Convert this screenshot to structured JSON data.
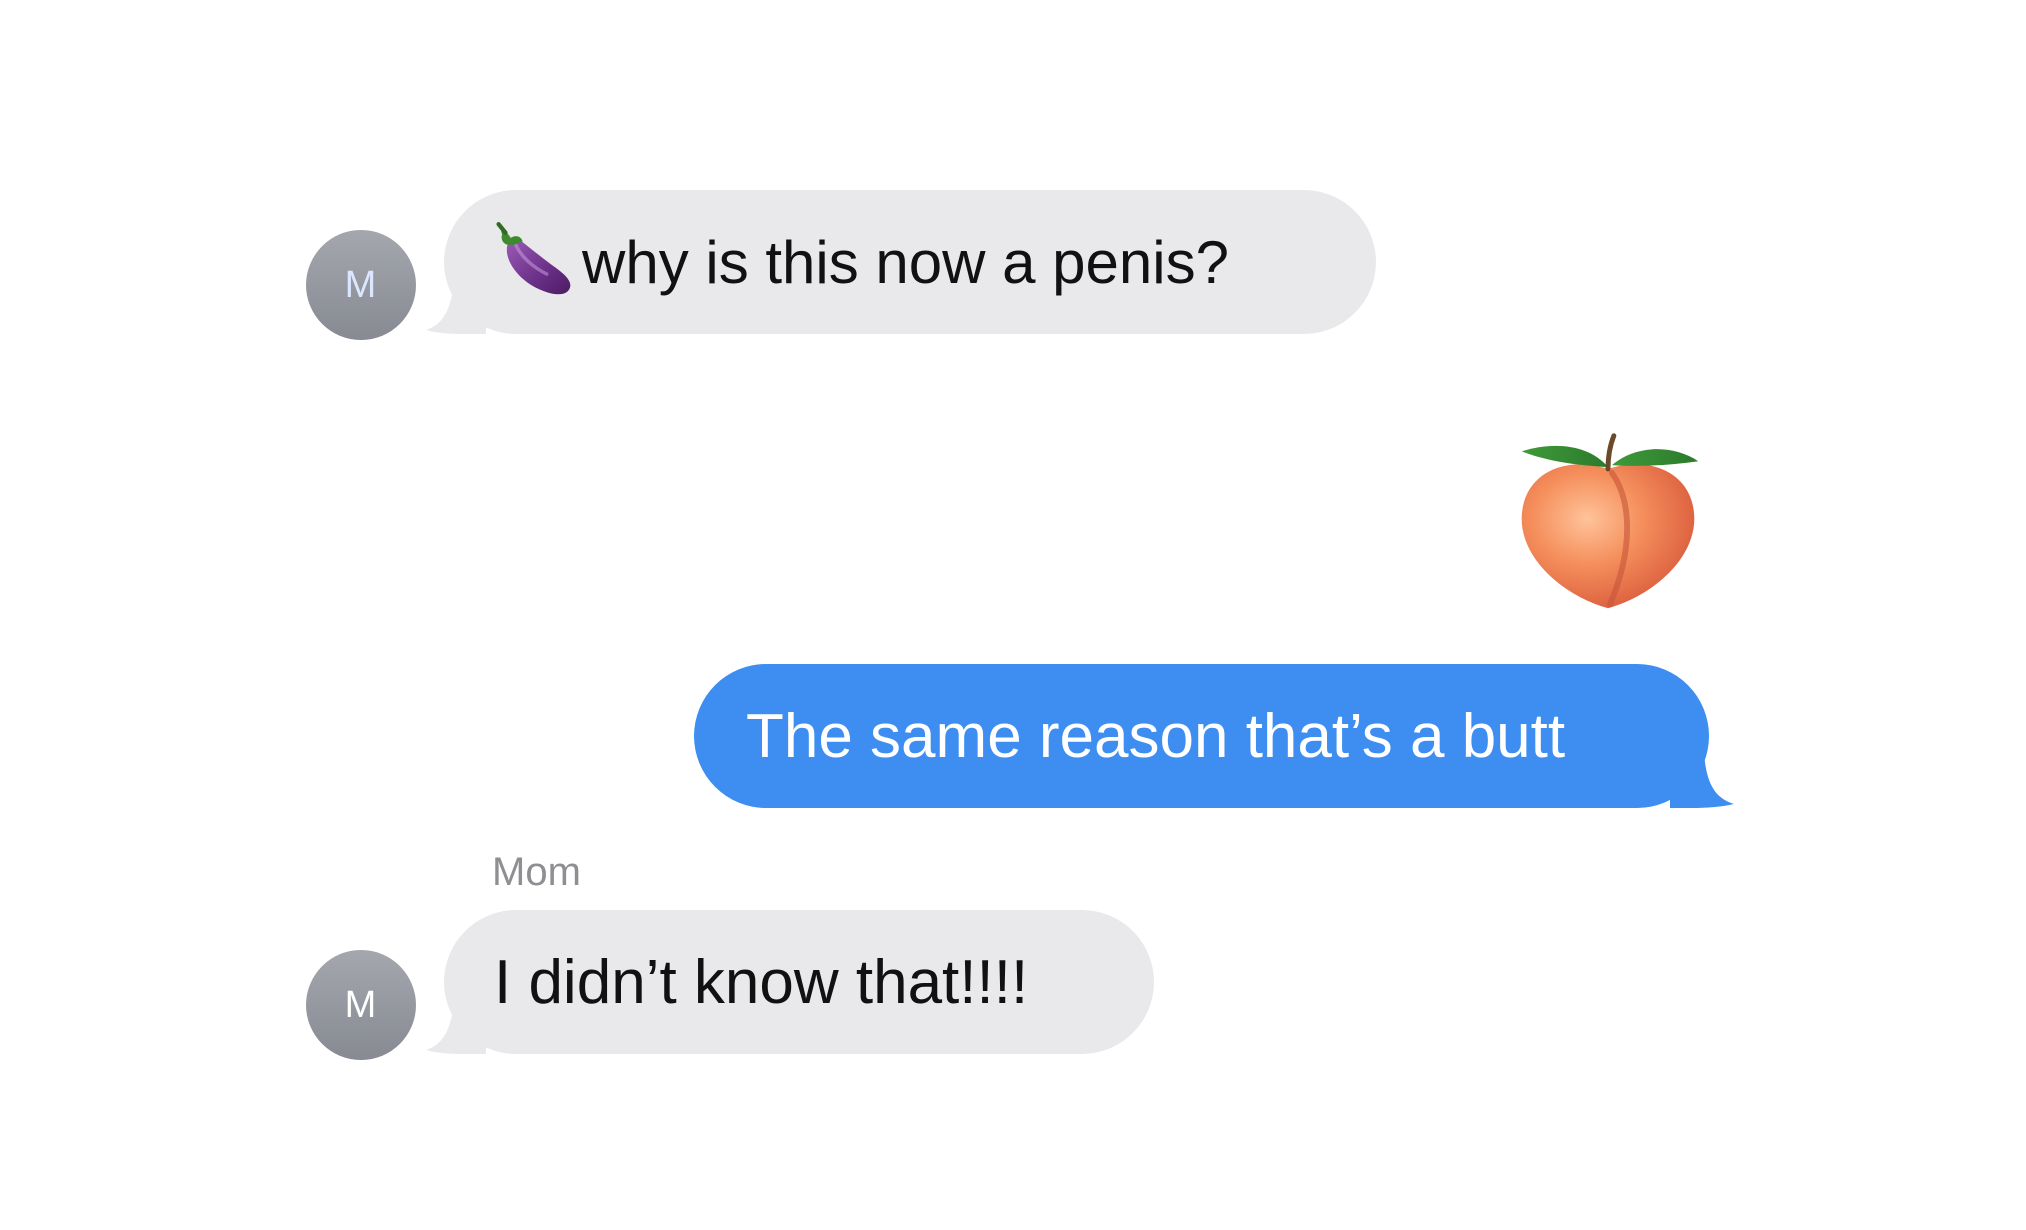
{
  "conversation": {
    "messages": [
      {
        "direction": "incoming",
        "avatar_initial": "M",
        "emoji_icon": "eggplant-icon",
        "text": "why is this now a penis?"
      },
      {
        "direction": "outgoing",
        "emoji_icon": "peach-icon",
        "text": "The same reason that’s a butt"
      },
      {
        "direction": "incoming",
        "sender_name": "Mom",
        "avatar_initial": "M",
        "text": "I didn’t know that!!!!"
      }
    ]
  },
  "colors": {
    "incoming_bubble": "#e9e9eb",
    "outgoing_bubble": "#3d8ef0",
    "avatar": "#8e9098",
    "sender_name": "#8e8e93"
  }
}
